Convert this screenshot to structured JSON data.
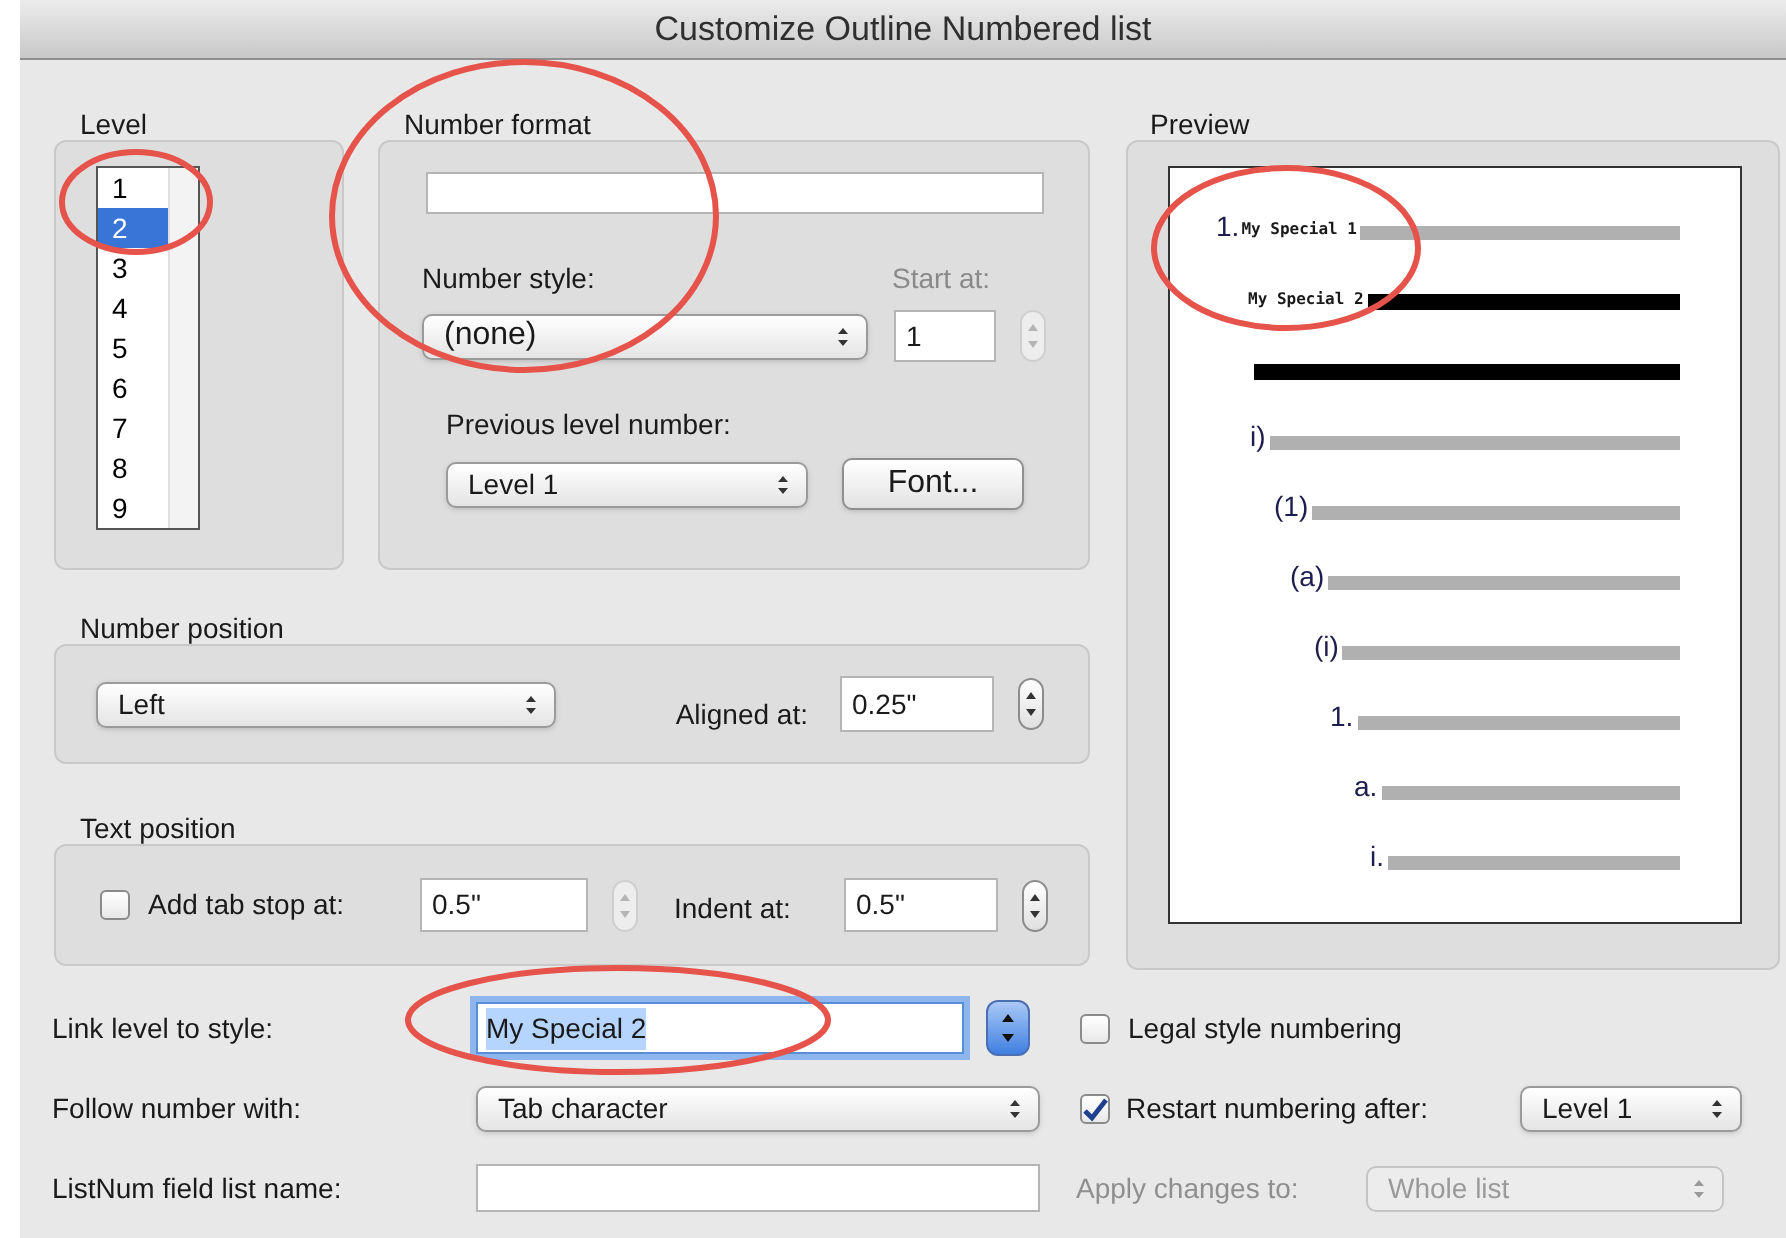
{
  "window": {
    "title": "Customize Outline Numbered list"
  },
  "level": {
    "label": "Level",
    "items": [
      {
        "text": "1",
        "selected": false
      },
      {
        "text": "2",
        "selected": true
      },
      {
        "text": "3",
        "selected": false
      },
      {
        "text": "4",
        "selected": false
      },
      {
        "text": "5",
        "selected": false
      },
      {
        "text": "6",
        "selected": false
      },
      {
        "text": "7",
        "selected": false
      },
      {
        "text": "8",
        "selected": false
      },
      {
        "text": "9",
        "selected": false
      }
    ]
  },
  "number_format": {
    "label": "Number format",
    "style_label": "Number style:",
    "style_value": "(none)",
    "start_label": "Start at:",
    "start_value": "1",
    "start_disabled": true,
    "previous_label": "Previous level number:",
    "previous_value": "Level 1",
    "font_button": "Font..."
  },
  "number_position": {
    "title": "Number position",
    "alignment": "Left",
    "aligned_label": "Aligned at:",
    "aligned_value": "0.25\""
  },
  "text_position": {
    "title": "Text position",
    "tab_stop": {
      "label": "Add tab stop at:",
      "checked": false,
      "value": "0.5\""
    },
    "indent_label": "Indent at:",
    "indent_value": "0.5\""
  },
  "preview": {
    "title": "Preview",
    "lines": [
      {
        "number": "1.",
        "style_text": "My Special 1",
        "highlighted": false
      },
      {
        "style_text": "My Special 2",
        "highlighted": true
      },
      {
        "highlighted": true
      },
      {
        "number": "i)",
        "highlighted": false
      },
      {
        "number": "(1)",
        "highlighted": false
      },
      {
        "number": "(a)",
        "highlighted": false
      },
      {
        "number": "(i)",
        "highlighted": false
      },
      {
        "number": "1.",
        "highlighted": false
      },
      {
        "number": "a.",
        "highlighted": false
      },
      {
        "number": "i.",
        "highlighted": false
      }
    ]
  },
  "link_level": {
    "label": "Link level to style:",
    "value": "My Special 2",
    "focused": true
  },
  "legal_style": {
    "label": "Legal style numbering",
    "checked": false
  },
  "follow_number": {
    "label": "Follow number with:",
    "value": "Tab character"
  },
  "restart": {
    "label": "Restart numbering after:",
    "checked": true,
    "value": "Level 1"
  },
  "listnum": {
    "label": "ListNum field list name:"
  },
  "apply_changes": {
    "label": "Apply changes to:",
    "value": "Whole list",
    "disabled": true
  }
}
